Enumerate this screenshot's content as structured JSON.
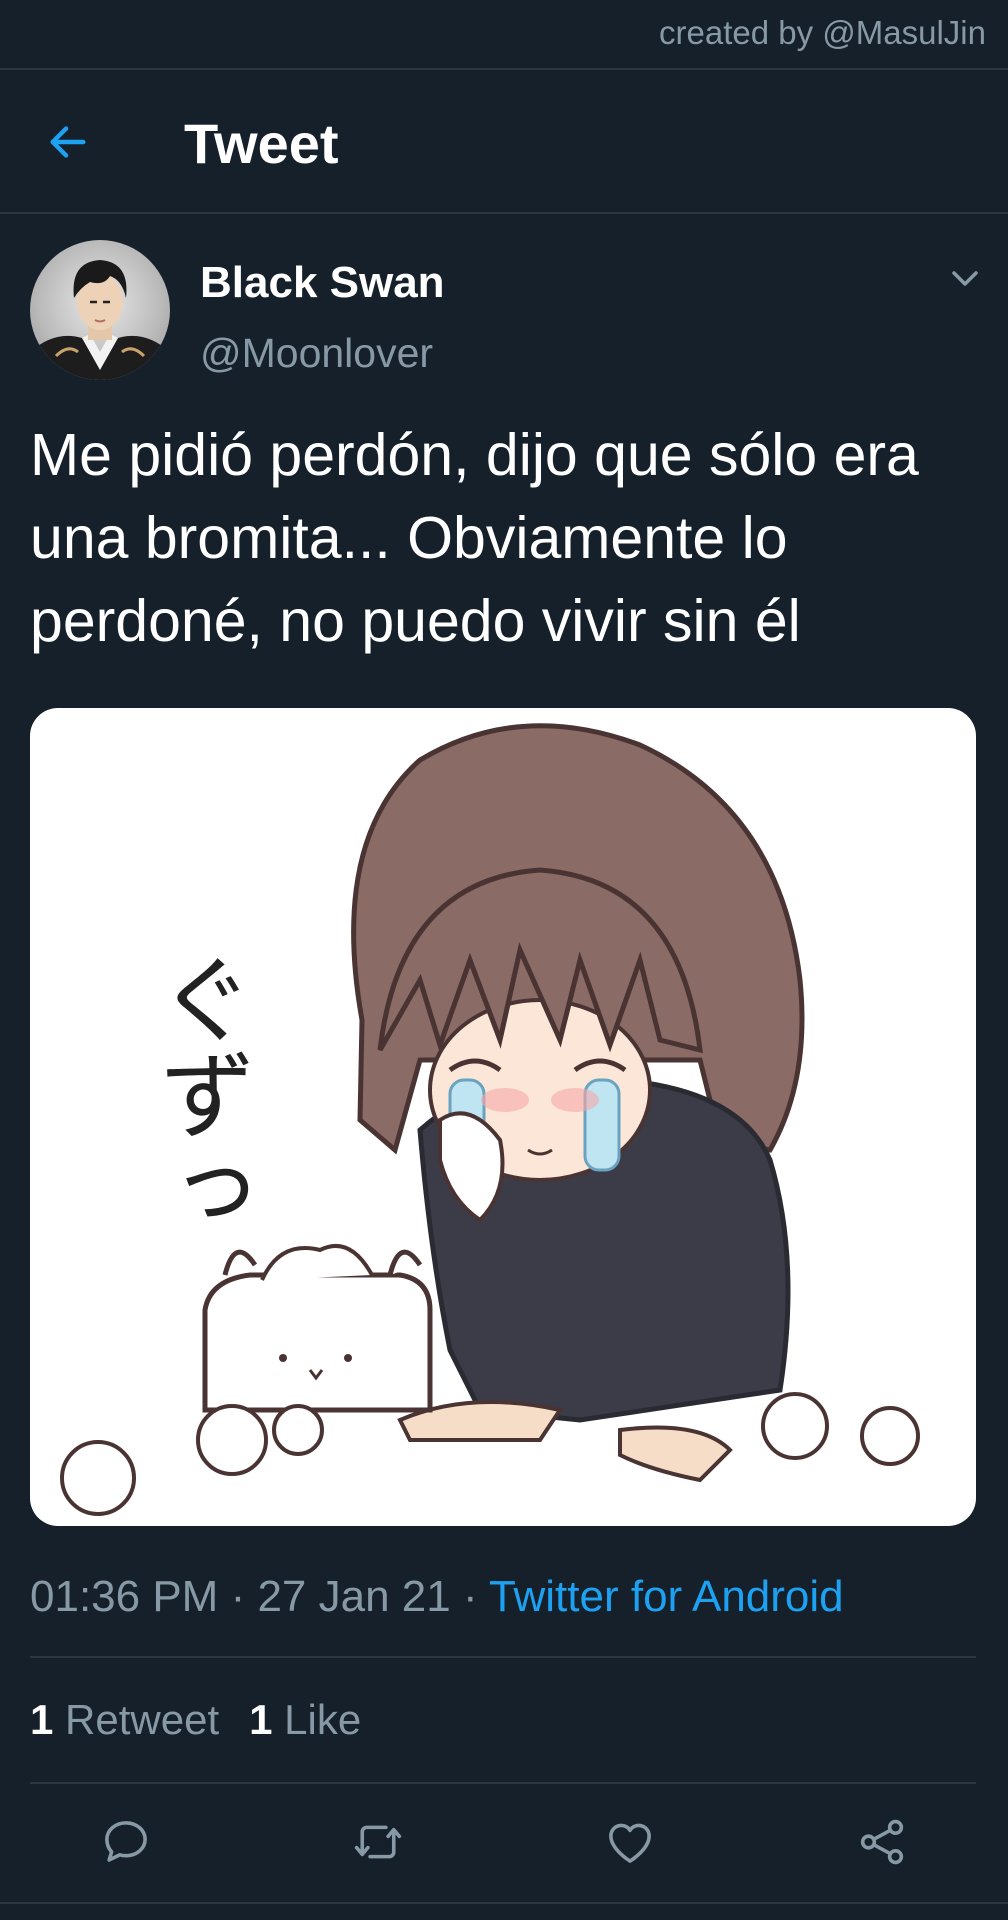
{
  "watermark": "created by @MasulJin",
  "header": {
    "title": "Tweet",
    "back_icon": "arrow-left-icon"
  },
  "tweet": {
    "author_name": "Black Swan",
    "author_handle": "@Moonlover",
    "text": "Me pidió perdón, dijo que sólo era una bromita... Obviamente lo perdoné, no puedo vivir sin él",
    "media_caption": "ぐずっ",
    "meta": {
      "time": "01:36 PM",
      "date": "27 Jan 21",
      "separator": " · ",
      "source": "Twitter for Android"
    },
    "stats": {
      "retweets_count": "1",
      "retweets_label": "Retweet",
      "likes_count": "1",
      "likes_label": "Like"
    }
  },
  "actions": [
    {
      "name": "reply",
      "icon": "comment-icon"
    },
    {
      "name": "retweet",
      "icon": "retweet-icon"
    },
    {
      "name": "like",
      "icon": "heart-icon"
    },
    {
      "name": "share",
      "icon": "share-icon"
    }
  ],
  "colors": {
    "background": "#15202b",
    "accent": "#1da1f2",
    "secondary_text": "#8899a6",
    "divider": "#2a3640"
  }
}
